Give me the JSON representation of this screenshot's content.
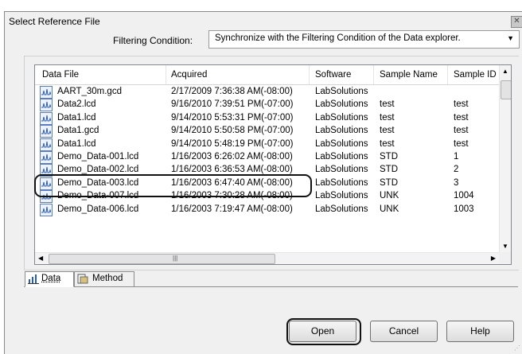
{
  "dialog": {
    "title": "Select Reference File",
    "close_glyph": "✕"
  },
  "filter": {
    "label": "Filtering Condition:",
    "selected": "Synchronize with the Filtering Condition of the Data explorer."
  },
  "columns": [
    "Data File",
    "Acquired",
    "Software",
    "Sample Name",
    "Sample ID"
  ],
  "rows": [
    {
      "file": "AART_30m.gcd",
      "acquired": "2/17/2009 7:36:38 AM(-08:00)",
      "software": "LabSolutions",
      "sample_name": "",
      "sample_id": ""
    },
    {
      "file": "Data2.lcd",
      "acquired": "9/16/2010 7:39:51 PM(-07:00)",
      "software": "LabSolutions",
      "sample_name": "test",
      "sample_id": "test"
    },
    {
      "file": "Data1.lcd",
      "acquired": "9/14/2010 5:53:31 PM(-07:00)",
      "software": "LabSolutions",
      "sample_name": "test",
      "sample_id": "test"
    },
    {
      "file": "Data1.gcd",
      "acquired": "9/14/2010 5:50:58 PM(-07:00)",
      "software": "LabSolutions",
      "sample_name": "test",
      "sample_id": "test"
    },
    {
      "file": "Data1.lcd",
      "acquired": "9/14/2010 5:48:19 PM(-07:00)",
      "software": "LabSolutions",
      "sample_name": "test",
      "sample_id": "test"
    },
    {
      "file": "Demo_Data-001.lcd",
      "acquired": "1/16/2003 6:26:02 AM(-08:00)",
      "software": "LabSolutions",
      "sample_name": "STD",
      "sample_id": "1"
    },
    {
      "file": "Demo_Data-002.lcd",
      "acquired": "1/16/2003 6:36:53 AM(-08:00)",
      "software": "LabSolutions",
      "sample_name": "STD",
      "sample_id": "2"
    },
    {
      "file": "Demo_Data-003.lcd",
      "acquired": "1/16/2003 6:47:40 AM(-08:00)",
      "software": "LabSolutions",
      "sample_name": "STD",
      "sample_id": "3"
    },
    {
      "file": "Demo_Data-007.lcd",
      "acquired": "1/16/2003 7:30:28 AM(-08:00)",
      "software": "LabSolutions",
      "sample_name": "UNK",
      "sample_id": "1004"
    },
    {
      "file": "Demo_Data-006.lcd",
      "acquired": "1/16/2003 7:19:47 AM(-08:00)",
      "software": "LabSolutions",
      "sample_name": "UNK",
      "sample_id": "1003"
    }
  ],
  "highlighted_row": "Demo_Data-001.lcd",
  "tabs": [
    {
      "label": "Data",
      "icon": "chart-icon",
      "active": true
    },
    {
      "label": "Method",
      "icon": "method-icon",
      "active": false
    }
  ],
  "buttons": {
    "open": "Open",
    "cancel": "Cancel",
    "help": "Help"
  },
  "colors": {
    "dialog_bg": "#f0f0f0",
    "highlight_ring": "#111111"
  }
}
